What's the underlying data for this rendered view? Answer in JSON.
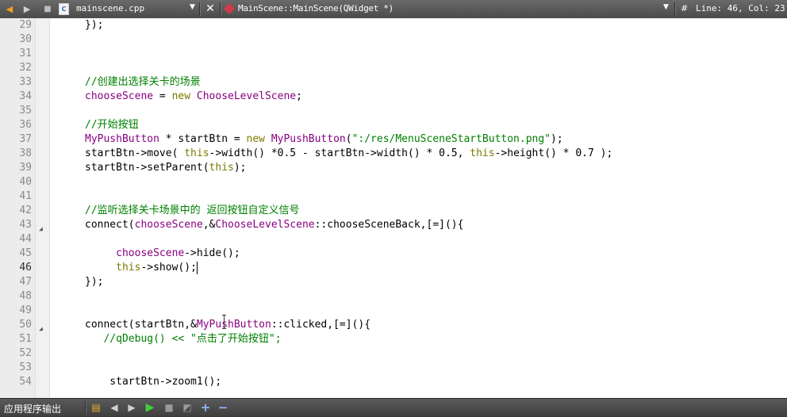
{
  "toolbar": {
    "file_name": "mainscene.cpp",
    "symbol": "MainScene::MainScene(QWidget *)",
    "hash": "#",
    "line_col": "Line: 46, Col: 23",
    "icons": [
      "back-arrow-icon",
      "forward-arrow-icon",
      "lock-icon",
      "cpp-file-icon",
      "dropdown-icon",
      "close-icon",
      "class-icon",
      "dropdown-icon"
    ]
  },
  "editor": {
    "current_line": 46,
    "lines": [
      {
        "n": "29",
        "text": "});"
      },
      {
        "n": "30",
        "text": ""
      },
      {
        "n": "31",
        "text": ""
      },
      {
        "n": "32",
        "text": ""
      },
      {
        "n": "33",
        "text": "//创建出选择关卡的场景"
      },
      {
        "n": "34",
        "text": "chooseScene = new ChooseLevelScene;"
      },
      {
        "n": "35",
        "text": ""
      },
      {
        "n": "36",
        "text": "//开始按钮"
      },
      {
        "n": "37",
        "text": "MyPushButton * startBtn = new MyPushButton(\":/res/MenuSceneStartButton.png\");"
      },
      {
        "n": "38",
        "text": "startBtn->move( this->width() *0.5 - startBtn->width() * 0.5, this->height() * 0.7 );"
      },
      {
        "n": "39",
        "text": "startBtn->setParent(this);"
      },
      {
        "n": "40",
        "text": ""
      },
      {
        "n": "41",
        "text": ""
      },
      {
        "n": "42",
        "text": "//监听选择关卡场景中的 返回按钮自定义信号"
      },
      {
        "n": "43",
        "text": "connect(chooseScene,&ChooseLevelScene::chooseSceneBack,[=](){"
      },
      {
        "n": "44",
        "text": ""
      },
      {
        "n": "45",
        "text": "     chooseScene->hide();"
      },
      {
        "n": "46",
        "text": "     this->show();"
      },
      {
        "n": "47",
        "text": "});"
      },
      {
        "n": "48",
        "text": ""
      },
      {
        "n": "49",
        "text": ""
      },
      {
        "n": "50",
        "text": "connect(startBtn,&MyPushButton::clicked,[=](){"
      },
      {
        "n": "51",
        "text": "   //qDebug() << \"点击了开始按钮\";"
      },
      {
        "n": "52",
        "text": ""
      },
      {
        "n": "53",
        "text": ""
      },
      {
        "n": "54",
        "text": "    startBtn->zoom1();"
      }
    ]
  },
  "bottom": {
    "panel_title": "应用程序输出",
    "icons": [
      "output-panel-icon",
      "prev-icon",
      "next-icon",
      "run-icon",
      "stop-icon",
      "attach-icon",
      "zoom-in-icon",
      "zoom-out-icon"
    ]
  },
  "colors": {
    "keyword": "#7a7a00",
    "identifier": "#880080",
    "string": "#008000",
    "comment": "#008000",
    "toolbar": "#555555"
  }
}
